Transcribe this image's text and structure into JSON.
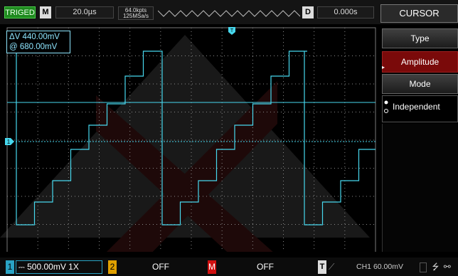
{
  "topbar": {
    "trig_status": "TRIGED",
    "mode_letter": "M",
    "timebase": "20.0µs",
    "memory_depth": "64.0kpts",
    "sample_rate": "125MSa/s",
    "delay_letter": "D",
    "trigger_position": "0.000s"
  },
  "menu": {
    "title": "CURSOR",
    "type_label": "Type",
    "type_value": "Amplitude",
    "mode_label": "Mode",
    "mode_value": "Independent"
  },
  "readout": {
    "delta": "ΔV 440.00mV",
    "at": "@ 680.00mV"
  },
  "bottombar": {
    "ch1_number": "1",
    "ch1_setting": "500.00mV 1X",
    "ch2_number": "2",
    "ch2_setting": "OFF",
    "math_letter": "M",
    "math_setting": "OFF",
    "trigger_letter": "T",
    "trigger_setting": "CH1 60.00mV"
  },
  "colors": {
    "ch1": "#2aa3c4",
    "trace": "#47d8ee",
    "triged": "#1f8a1f",
    "menu_selected": "#7a0a0a",
    "math": "#d01010",
    "ch2": "#e0a000"
  },
  "icons": [
    "usb-icon",
    "network-icon"
  ]
}
